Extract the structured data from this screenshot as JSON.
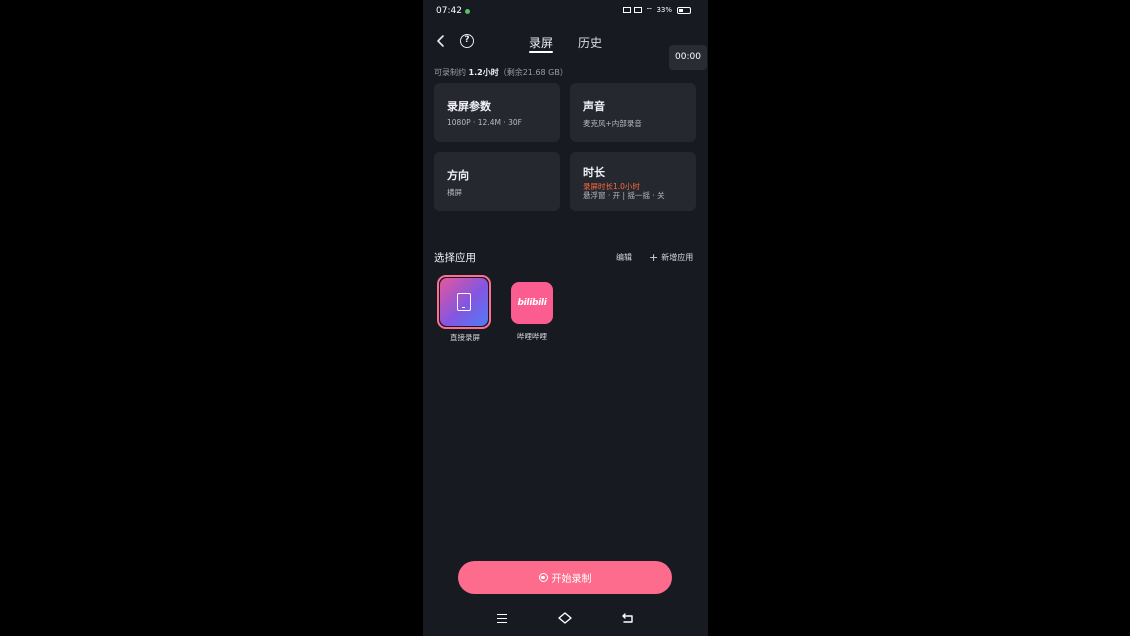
{
  "status_bar": {
    "time": "07:42",
    "battery": "33%"
  },
  "header": {
    "tabs": [
      {
        "label": "录屏",
        "active": true
      },
      {
        "label": "历史",
        "active": false
      }
    ],
    "timer": "00:00"
  },
  "capacity": {
    "prefix": "可录制约 ",
    "highlight": "1.2小时",
    "suffix": "（剩余21.68 GB）"
  },
  "cards": {
    "params": {
      "title": "录屏参数",
      "sub": "1080P · 12.4M · 30F"
    },
    "sound": {
      "title": "声音",
      "sub": "麦克风+内部录音"
    },
    "orientation": {
      "title": "方向",
      "sub": "横屏"
    },
    "duration": {
      "title": "时长",
      "warn": "录屏时长1.0小时",
      "sub": "悬浮窗 · 开 | 摇一摇 · 关"
    }
  },
  "apps_section": {
    "title": "选择应用",
    "edit_label": "编辑",
    "add_label": "新增应用",
    "apps": [
      {
        "label": "直接录屏",
        "selected": true
      },
      {
        "label": "哔哩哔哩",
        "icon_text": "bilibili",
        "selected": false
      }
    ]
  },
  "start_button": {
    "label": "开始录制"
  },
  "colors": {
    "accent": "#fd6b8d",
    "background": "#181a22",
    "card": "#262830",
    "warning": "#ff6a3d"
  }
}
